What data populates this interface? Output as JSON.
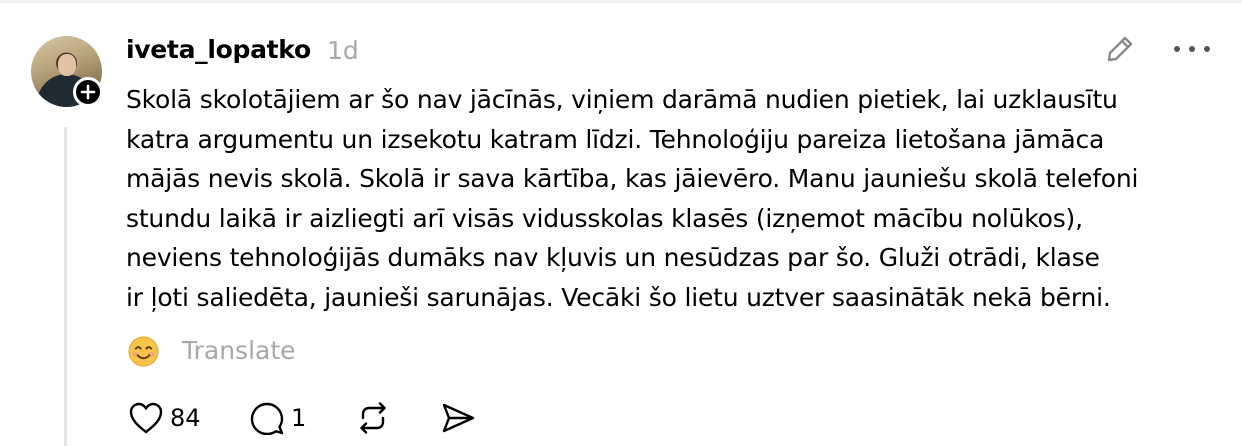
{
  "post": {
    "username": "iveta_lopatko",
    "timestamp": "1d",
    "lines": [
      "Skolā skolotājiem ar šo nav jācīnās, viņiem darāmā nudien pietiek, lai uzklausītu",
      "katra argumentu un izsekotu katram līdzi. Tehnoloģiju pareiza lietošana jāmāca",
      "mājās nevis skolā. Skolā ir sava kārtība, kas jāievēro. Manu jauniešu skolā telefoni",
      "stundu laikā ir aizliegti arī visās vidusskolas klasēs (izņemot mācību nolūkos),",
      "neviens tehnoloģijās dumāks nav kļuvis un nesūdzas par šo. Gluži otrādi, klase",
      "ir ļoti saliedēta, jaunieši sarunājas. Vecāki šo lietu uztver saasinātāk nekā bērni."
    ],
    "translate_label": "Translate"
  },
  "actions": {
    "likes": "84",
    "replies": "1"
  },
  "icons": {
    "edit": "pencil-icon",
    "more": "more-horizontal-icon",
    "emoji": "smiling-face-emoji",
    "like": "heart-icon",
    "reply": "speech-bubble-icon",
    "repost": "repost-icon",
    "share": "send-icon",
    "follow": "plus-icon"
  }
}
